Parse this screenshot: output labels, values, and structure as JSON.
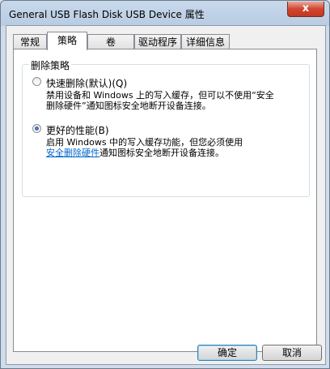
{
  "window": {
    "title": "General USB Flash Disk USB Device 属性",
    "close_symbol": "x"
  },
  "tabs": [
    {
      "label": "常规"
    },
    {
      "label": "策略",
      "active": true
    },
    {
      "label": "卷"
    },
    {
      "label": "驱动程序"
    },
    {
      "label": "详细信息"
    }
  ],
  "group": {
    "label": "删除策略",
    "option1": {
      "label": "快速删除(默认)(Q)",
      "selected": false,
      "desc_line1": "禁用设备和 Windows 上的写入缓存，但可以不使用“安全",
      "desc_line2": "删除硬件”通知图标安全地断开设备连接。"
    },
    "option2": {
      "label": "更好的性能(B)",
      "selected": true,
      "desc_line1": "启用 Windows 中的写入缓存功能，但您必须使用",
      "link": "安全删除硬件",
      "desc_line2_rest": "通知图标安全地断开设备连接。"
    }
  },
  "buttons": {
    "ok": "确定",
    "cancel": "取消"
  }
}
